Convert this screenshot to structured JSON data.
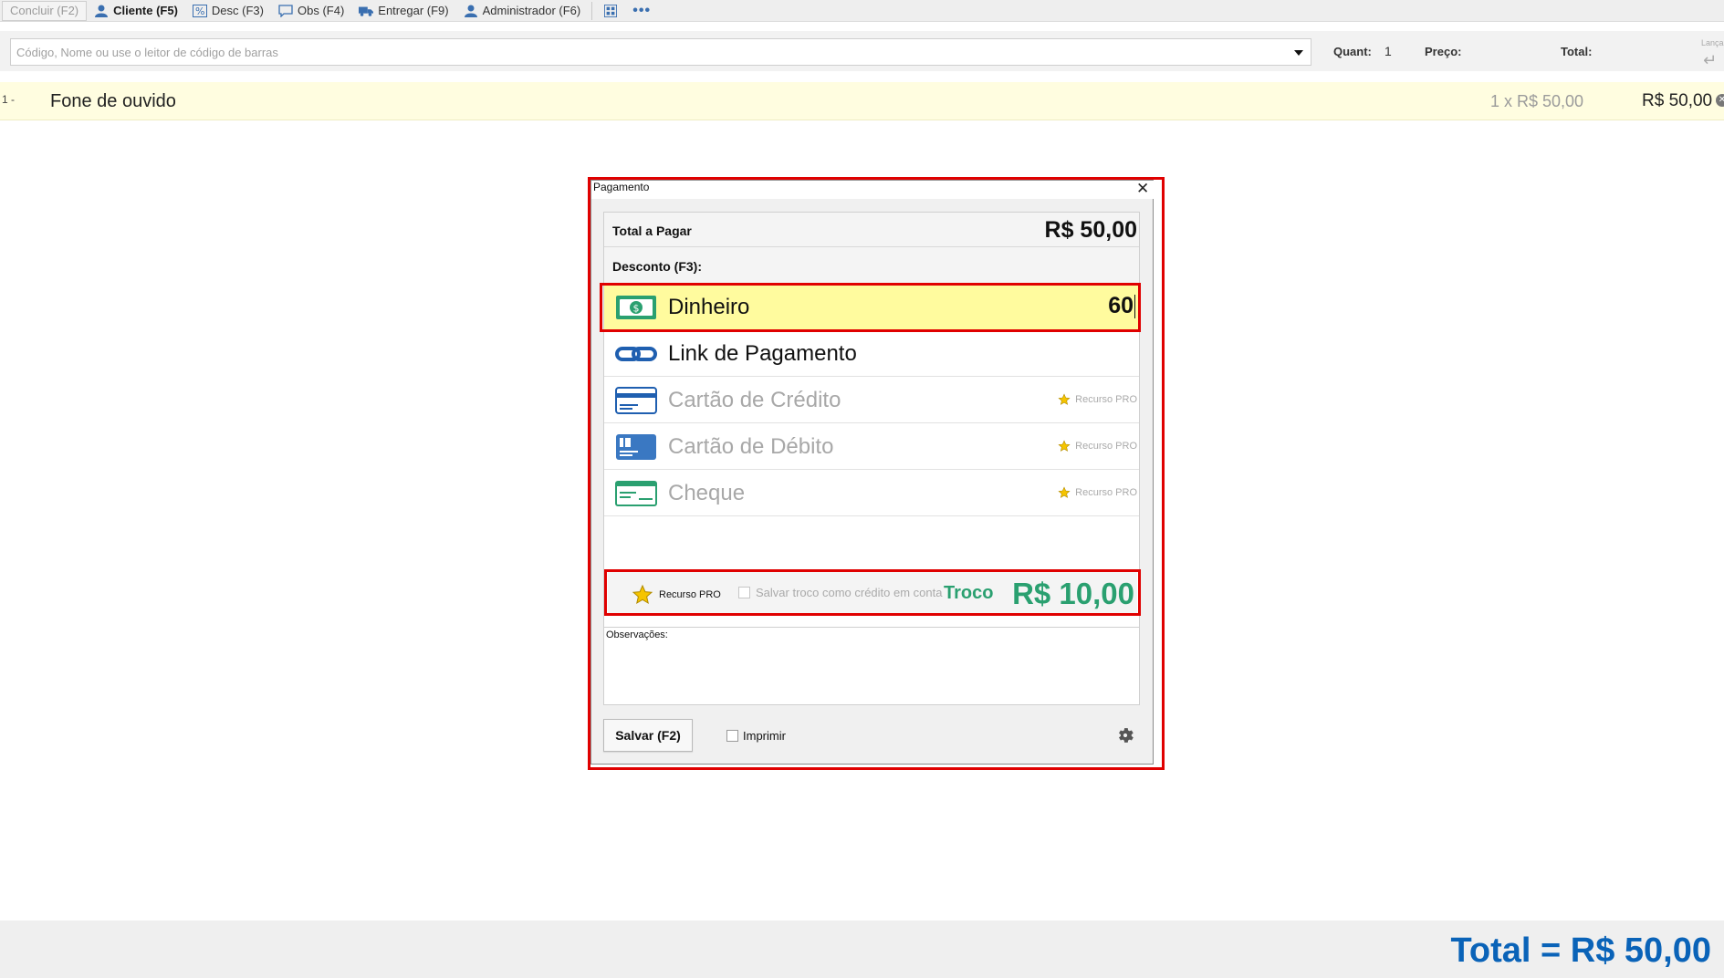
{
  "toolbar": {
    "concluir": "Concluir (F2)",
    "cliente": "Cliente (F5)",
    "desc": "Desc (F3)",
    "obs": "Obs (F4)",
    "entregar": "Entregar (F9)",
    "administrador": "Administrador (F6)",
    "more": "•••"
  },
  "search": {
    "placeholder": "Código, Nome ou use o leitor de código de barras",
    "quant_label": "Quant:",
    "quant_value": "1",
    "preco_label": "Preço:",
    "total_label": "Total:",
    "lanca_label": "Lança"
  },
  "item": {
    "number": "1 -",
    "name": "Fone de ouvido",
    "qty_price": "1  x  R$ 50,00",
    "total": "R$ 50,00"
  },
  "dialog": {
    "title": "Pagamento",
    "total_label": "Total a Pagar",
    "total_value": "R$ 50,00",
    "discount_label": "Desconto (F3):",
    "methods": [
      {
        "label": "Dinheiro",
        "amount": "60",
        "icon": "cash-icon"
      },
      {
        "label": "Link de Pagamento",
        "icon": "link-icon"
      },
      {
        "label": "Cartão de Crédito",
        "pro": "Recurso PRO",
        "icon": "credit-card-icon"
      },
      {
        "label": "Cartão de Débito",
        "pro": "Recurso PRO",
        "icon": "debit-card-icon"
      },
      {
        "label": "Cheque",
        "pro": "Recurso PRO",
        "icon": "cheque-icon"
      }
    ],
    "pro_label": "Recurso PRO",
    "save_change_label": "Salvar troco como crédito em conta",
    "troco_label": "Troco",
    "troco_value": "R$ 10,00",
    "obs_label": "Observações:",
    "save_button": "Salvar (F2)",
    "print_label": "Imprimir"
  },
  "footer": {
    "grand_total": "Total = R$ 50,00"
  },
  "colors": {
    "accent_blue": "#0a63b8",
    "change_green": "#2aa070",
    "highlight_red": "#e00000",
    "selected_yellow": "#fffb9e"
  }
}
